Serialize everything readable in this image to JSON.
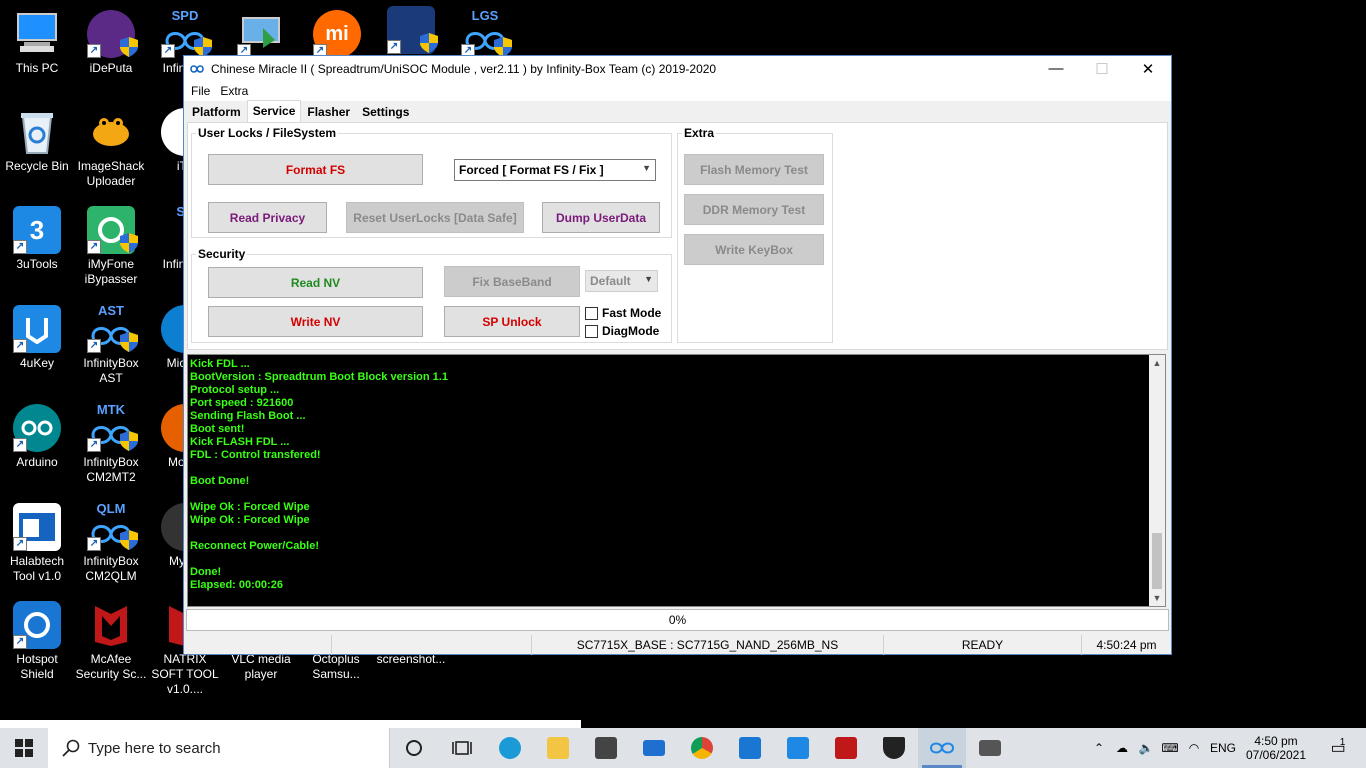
{
  "desktop": {
    "icons": [
      {
        "label": "This PC"
      },
      {
        "label": "iDePuta"
      },
      {
        "label": "Infin CM"
      },
      {
        "label": ""
      },
      {
        "label": ""
      },
      {
        "label": ""
      },
      {
        "label": ""
      },
      {
        "label": "Recycle Bin"
      },
      {
        "label": "ImageShack Uploader"
      },
      {
        "label": "iTu"
      },
      {
        "label": "3uTools"
      },
      {
        "label": "iMyFone iBypasser"
      },
      {
        "label": "Infin CM"
      },
      {
        "label": "4uKey"
      },
      {
        "label": "InfinityBox AST"
      },
      {
        "label": "Mic Ed"
      },
      {
        "label": "Arduino"
      },
      {
        "label": "InfinityBox CM2MT2"
      },
      {
        "label": "Mo Fir"
      },
      {
        "label": "Halabtech Tool v1.0"
      },
      {
        "label": "InfinityBox CM2QLM"
      },
      {
        "label": "Myste"
      },
      {
        "label": "Hotspot Shield"
      },
      {
        "label": "McAfee Security Sc..."
      },
      {
        "label": "NATRIX SOFT TOOL v1.0...."
      },
      {
        "label": "VLC media player"
      },
      {
        "label": "Octoplus Samsu..."
      },
      {
        "label": "screenshot..."
      }
    ],
    "badges": {
      "spd": "SPD",
      "lgs": "LGS",
      "ast": "AST",
      "mtk": "MTK",
      "qlm": "QLM",
      "sp2": "SP",
      "mi": "mi"
    }
  },
  "window": {
    "title": "Chinese Miracle II ( Spreadtrum/UniSOC Module , ver2.11  ) by Infinity-Box Team (c) 2019-2020",
    "controls": {
      "minimize": "—",
      "maximize": "☐",
      "close": "✕"
    },
    "menu": [
      "File",
      "Extra"
    ],
    "tabs": [
      "Platform",
      "Service",
      "Flasher",
      "Settings"
    ],
    "active_tab": "Service"
  },
  "user_locks": {
    "title": "User Locks  / FileSystem",
    "format_fs": "Format FS",
    "format_mode": "Forced [ Format FS / Fix ]",
    "read_privacy": "Read Privacy",
    "reset_userlocks": "Reset UserLocks [Data Safe]",
    "dump_userdata": "Dump UserData"
  },
  "security": {
    "title": "Security",
    "read_nv": "Read NV",
    "write_nv": "Write NV",
    "fix_baseband": "Fix BaseBand",
    "baseband_mode": "Default",
    "sp_unlock": "SP Unlock",
    "fast_mode": "Fast Mode",
    "diag_mode": "DiagMode"
  },
  "extra": {
    "title": "Extra",
    "flash_memory_test": "Flash Memory Test",
    "ddr_memory_test": "DDR Memory Test",
    "write_keybox": "Write KeyBox"
  },
  "log": [
    "Kick FDL ...",
    "BootVersion : Spreadtrum Boot Block version 1.1",
    "Protocol setup ...",
    "Port speed : 921600",
    "Sending Flash Boot ...",
    "Boot sent!",
    "Kick FLASH FDL ...",
    "FDL : Control transfered!",
    "",
    "Boot Done!",
    "",
    "Wipe Ok : Forced Wipe",
    "Wipe Ok : Forced Wipe",
    "",
    "Reconnect Power/Cable!",
    "",
    "Done!",
    "Elapsed: 00:00:26"
  ],
  "progress": {
    "text": "0%",
    "value": 0
  },
  "status": {
    "cell1": "",
    "cell2": "",
    "chip": "SC7715X_BASE : SC7715G_NAND_256MB_NS",
    "state": "READY",
    "time": "4:50:24 pm"
  },
  "taskbar": {
    "search_placeholder": "Type here to search",
    "lang": "ENG",
    "clock_time": "4:50 pm",
    "clock_date": "07/06/2021",
    "notification_count": "1",
    "apps": [
      "task-view",
      "edge",
      "file-explorer",
      "store",
      "mail",
      "chrome",
      "hotspot-shield",
      "3utools",
      "mcafee",
      "security",
      "cm2",
      "network-app"
    ]
  },
  "colors": {
    "log_text": "#39ff14",
    "red_button": "#d40000",
    "purple_button": "#7a1a7a",
    "green_button": "#1f8a1f"
  }
}
